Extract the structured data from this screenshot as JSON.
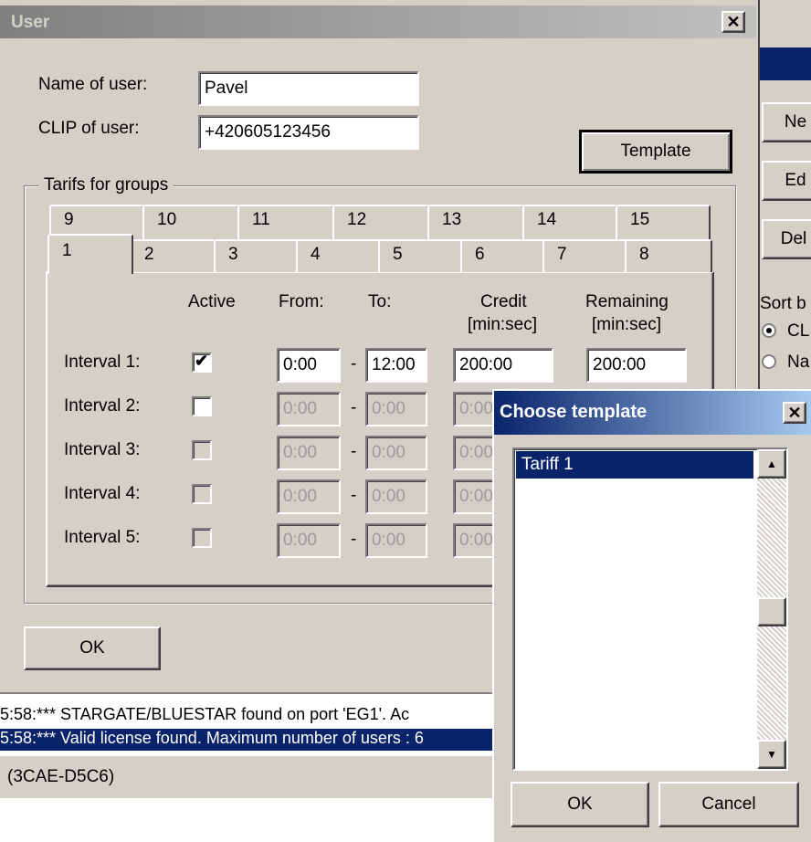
{
  "user_dialog": {
    "title": "User",
    "close": "✕",
    "name_label": "Name of user:",
    "name_value": "Pavel",
    "clip_label": "CLIP of user:",
    "clip_value": "+420605123456",
    "template_button": "Template",
    "group_label": "Tarifs for groups",
    "tabs_back": [
      "9",
      "10",
      "11",
      "12",
      "13",
      "14",
      "15"
    ],
    "tabs_front": [
      "1",
      "2",
      "3",
      "4",
      "5",
      "6",
      "7",
      "8"
    ],
    "headers": {
      "active": "Active",
      "from": "From:",
      "to": "To:",
      "credit": "Credit\n[min:sec]",
      "credit_1": "Credit",
      "credit_2": "[min:sec]",
      "remaining_1": "Remaining",
      "remaining_2": "[min:sec]"
    },
    "intervals": [
      {
        "label": "Interval 1:",
        "active": true,
        "from": "0:00",
        "to": "12:00",
        "credit": "200:00",
        "remaining": "200:00"
      },
      {
        "label": "Interval 2:",
        "active": false,
        "from": "0:00",
        "to": "0:00",
        "credit": "0:00"
      },
      {
        "label": "Interval 3:",
        "active": false,
        "from": "0:00",
        "to": "0:00",
        "credit": "0:00"
      },
      {
        "label": "Interval 4:",
        "active": false,
        "from": "0:00",
        "to": "0:00",
        "credit": "0:00"
      },
      {
        "label": "Interval 5:",
        "active": false,
        "from": "0:00",
        "to": "0:00",
        "credit": "0:00"
      }
    ],
    "dash": "-",
    "ok_button": "OK"
  },
  "right_panel": {
    "btn_new": "Ne",
    "btn_edit": "Ed",
    "btn_delete": "Del",
    "sort_label": "Sort b",
    "radio_clip": "CL",
    "radio_name": "Na"
  },
  "log": {
    "line_1": "5:58:*** STARGATE/BLUESTAR found on port 'EG1'. Ac",
    "line_2": "5:58:*** Valid license found. Maximum number of users : 6",
    "status": "(3CAE-D5C6)"
  },
  "template_dialog": {
    "title": "Choose template",
    "close": "✕",
    "items": [
      "Tariff 1"
    ],
    "ok_button": "OK",
    "cancel_button": "Cancel"
  }
}
